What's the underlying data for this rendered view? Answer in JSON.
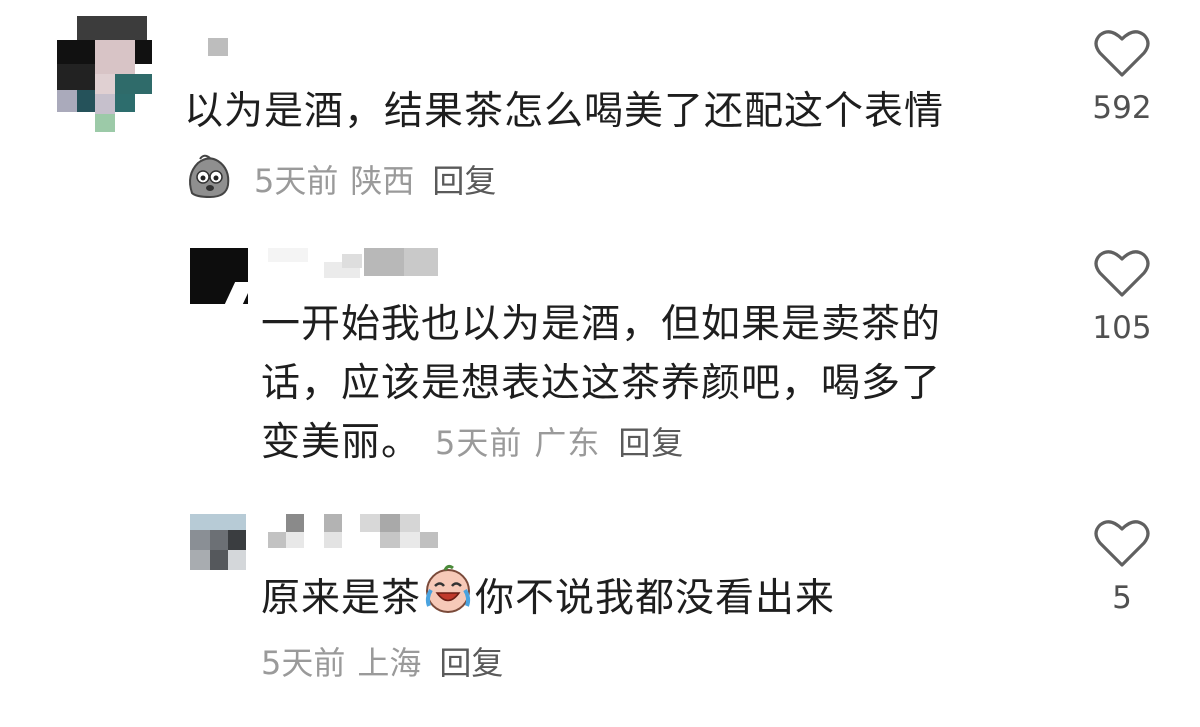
{
  "comments": [
    {
      "text": "以为是酒，结果茶怎么喝美了还配这个表情",
      "time": "5天前",
      "location": "陕西",
      "reply_label": "回复",
      "likes": "592",
      "sticker": "gray-blob-sticker-icon"
    },
    {
      "text_line1": "一开始我也以为是酒，但如果是卖茶的",
      "text_line2": "话，应该是想表达这茶养颜吧，喝多了",
      "text_line3": "变美丽。",
      "time": "5天前",
      "location": "广东",
      "reply_label": "回复",
      "likes": "105"
    },
    {
      "text_before": "原来是茶",
      "text_after": "你不说我都没看出来",
      "inline_emoji": "crying-laughing-face-icon",
      "time": "5天前",
      "location": "上海",
      "reply_label": "回复",
      "likes": "5"
    }
  ],
  "colors": {
    "text": "#1e1e1e",
    "meta": "#9a9a9a",
    "reply": "#5a5a5a",
    "heart": "#606060"
  }
}
